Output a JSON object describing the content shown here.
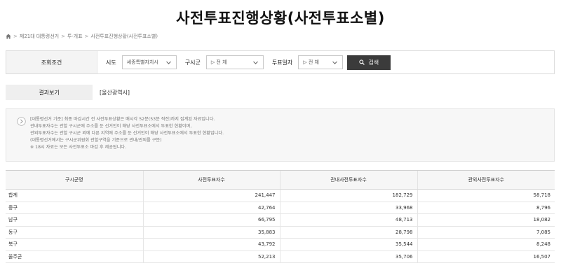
{
  "title": "사전투표진행상황(사전투표소별)",
  "breadcrumb": [
    "제21대 대통령선거",
    "투·개표",
    "사전투표진행상황(사전투표소별)"
  ],
  "search": {
    "section_label": "조회조건",
    "sido_label": "시도",
    "sido_value": "세종특별자치시",
    "gusi_label": "구시군",
    "gusi_value": "▷ 전 체",
    "date_label": "투표일자",
    "date_value": "▷ 전 체",
    "button_label": "검색"
  },
  "result": {
    "label": "결과보기",
    "value": "[울산광역시]"
  },
  "notice": [
    "[대통령선거 기준] 최종 마감시간 전 사전투표상황은 매시각 52분(53분 직전)까지 집계된 자료입니다.",
    "관내투표자수는 관할 구시군에 주소를 둔 선거인이 해당 사전투표소에서 투표한 현황이며,",
    "관외투표자수는 관할 구시군 외에 다른 지역에 주소를 둔 선거인이 해당 사전투표소에서 투표한 현황입니다.",
    "(대통령선거에서는 구시군위원회 관할구역을 기준으로 관내/관외를 구분)",
    "※ 18시 자료는 모든 사전투표소 마감 후 제공됩니다."
  ],
  "table": {
    "headers": [
      "구시군명",
      "사전투표자수",
      "관내사전투표자수",
      "관외사전투표자수"
    ],
    "rows": [
      [
        "합계",
        "241,447",
        "182,729",
        "58,718"
      ],
      [
        "중구",
        "42,764",
        "33,968",
        "8,796"
      ],
      [
        "남구",
        "66,795",
        "48,713",
        "18,082"
      ],
      [
        "동구",
        "35,883",
        "28,798",
        "7,085"
      ],
      [
        "북구",
        "43,792",
        "35,544",
        "8,248"
      ],
      [
        "울주군",
        "52,213",
        "35,706",
        "16,507"
      ]
    ]
  }
}
